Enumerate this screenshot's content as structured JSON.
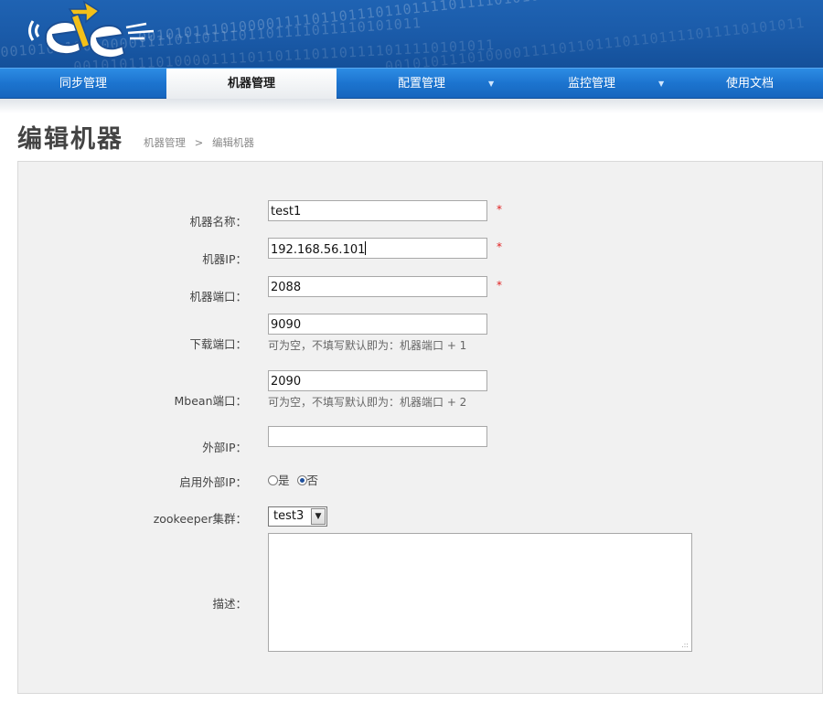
{
  "nav": {
    "items": [
      {
        "label": "同步管理"
      },
      {
        "label": "机器管理"
      },
      {
        "label": "配置管理"
      },
      {
        "label": "监控管理"
      },
      {
        "label": "使用文档"
      }
    ],
    "active_index": 1,
    "dropdown_caret": "▼"
  },
  "header": {
    "binary_text": "0010101110100001111011011101101111011110101011",
    "colors": {
      "header_blue": "#1a5aa8",
      "nav_blue": "#1c74cf",
      "active_tab": "#e9ecef"
    }
  },
  "page": {
    "title": "编辑机器",
    "breadcrumb": {
      "parent": "机器管理",
      "separator": ">",
      "current": "编辑机器"
    }
  },
  "form": {
    "machine_name": {
      "label": "机器名称：",
      "value": "test1",
      "required": "*"
    },
    "machine_ip": {
      "label": "机器IP：",
      "value": "192.168.56.101",
      "required": "*"
    },
    "machine_port": {
      "label": "机器端口：",
      "value": "2088",
      "required": "*"
    },
    "download_port": {
      "label": "下载端口：",
      "value": "9090",
      "hint": "可为空，不填写默认即为：机器端口 + 1"
    },
    "mbean_port": {
      "label": "Mbean端口：",
      "value": "2090",
      "hint": "可为空，不填写默认即为：机器端口 + 2"
    },
    "external_ip": {
      "label": "外部IP：",
      "value": ""
    },
    "enable_external_ip": {
      "label": "启用外部IP：",
      "options": [
        "是",
        "否"
      ],
      "selected": "否"
    },
    "zookeeper_cluster": {
      "label": "zookeeper集群：",
      "value": "test3"
    },
    "description": {
      "label": "描述：",
      "value": ""
    }
  }
}
